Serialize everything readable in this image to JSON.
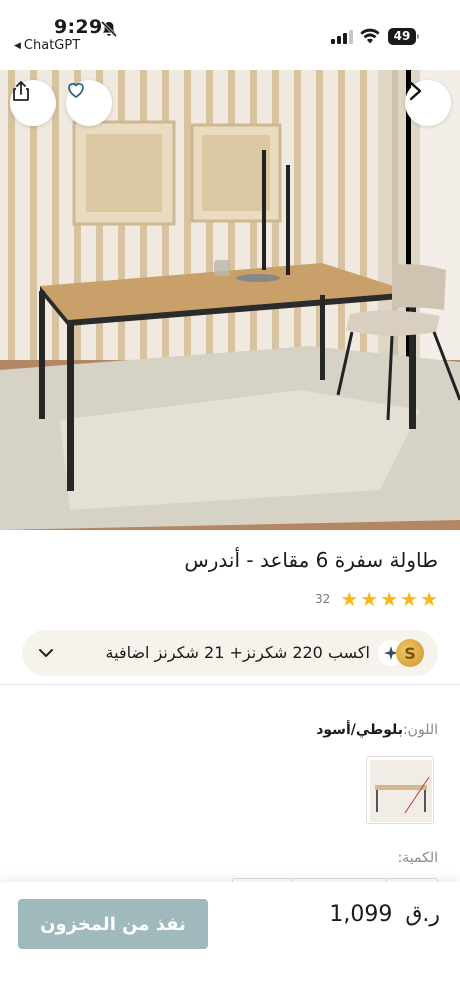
{
  "status_bar": {
    "time": "9:29",
    "back_app": "ChatGPT",
    "battery": "49",
    "icons": [
      "bell-slash-icon",
      "signal-icon",
      "wifi-icon",
      "battery-icon"
    ]
  },
  "gallery": {
    "buttons": [
      "share-icon",
      "heart-icon",
      "chevron-right-icon"
    ]
  },
  "product": {
    "title": "طاولة سفرة 6 مقاعد - أندرس",
    "rating": 5,
    "review_count": "32",
    "rewards_text": "اكسب 220 شكرنز+  21 شكرنز اضافية",
    "coin_letter": "S",
    "color_label": "اللون:",
    "color_value": "بلوطي/أسود",
    "quantity_label": "الكمية:"
  },
  "footer": {
    "out_of_stock_label": "نفذ من المخزون",
    "price_amount": "1,099",
    "price_currency": "ر.ق"
  },
  "colors": {
    "star": "#f6b91a",
    "button_disabled": "#9fb9bd",
    "rewards_bg": "#f6f3ec"
  }
}
